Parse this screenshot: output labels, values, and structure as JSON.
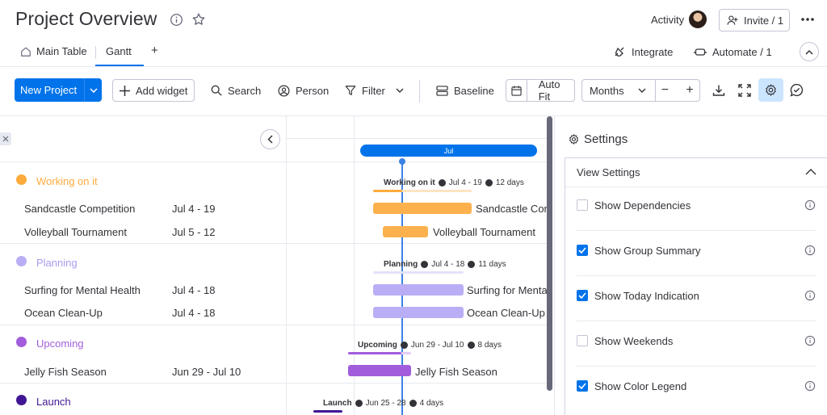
{
  "header": {
    "title": "Project Overview",
    "activity_label": "Activity",
    "invite_label": "Invite / 1",
    "icons": [
      "info-icon",
      "star-icon",
      "avatar",
      "add-person-icon",
      "more-icon"
    ]
  },
  "tabs": {
    "main_table": "Main Table",
    "gantt": "Gantt",
    "add": "+",
    "integrate": "Integrate",
    "automate": "Automate / 1"
  },
  "toolbar": {
    "new_project": "New Project",
    "add_widget": "Add widget",
    "search": "Search",
    "person": "Person",
    "filter": "Filter",
    "baseline": "Baseline",
    "auto_fit": "Auto Fit",
    "months": "Months",
    "zoom_out": "−",
    "zoom_in": "+"
  },
  "timeline": {
    "month": "Jul"
  },
  "groups": [
    {
      "name": "Working on it",
      "color": "#fdab3d",
      "summary": {
        "title": "Working on it",
        "range": "Jul 4 - 19",
        "duration": "12 days"
      },
      "items": [
        {
          "name": "Sandcastle Competition",
          "date": "Jul 4 - 19",
          "bar_label": "Sandcastle Con"
        },
        {
          "name": "Volleyball Tournament",
          "date": "Jul 5 - 12",
          "bar_label": "Volleyball Tournament"
        }
      ]
    },
    {
      "name": "Planning",
      "color": "#a25ddc",
      "light": "#b9aef5",
      "summary": {
        "title": "Planning",
        "range": "Jul 4 - 18",
        "duration": "11 days"
      },
      "items": [
        {
          "name": "Surfing for Mental Health",
          "date": "Jul 4 - 18",
          "bar_label": "Surfing for Menta"
        },
        {
          "name": "Ocean Clean-Up",
          "date": "Jul 4 - 18",
          "bar_label": "Ocean Clean-Up"
        }
      ]
    },
    {
      "name": "Upcoming",
      "color": "#a25ddc",
      "summary": {
        "title": "Upcoming",
        "range": "Jun 29 - Jul 10",
        "duration": "8 days"
      },
      "items": [
        {
          "name": "Jelly Fish Season",
          "date": "Jun 29 - Jul 10",
          "bar_label": "Jelly Fish Season"
        }
      ]
    },
    {
      "name": "Launch",
      "color": "#401694",
      "summary": {
        "title": "Launch",
        "range": "Jun 25 - 28",
        "duration": "4 days"
      },
      "items": []
    }
  ],
  "settings": {
    "title": "Settings",
    "view_settings": "View Settings",
    "options": [
      {
        "label": "Show Dependencies",
        "checked": false
      },
      {
        "label": "Show Group Summary",
        "checked": true
      },
      {
        "label": "Show Today Indication",
        "checked": true
      },
      {
        "label": "Show Weekends",
        "checked": false
      },
      {
        "label": "Show Color Legend",
        "checked": true
      }
    ]
  }
}
